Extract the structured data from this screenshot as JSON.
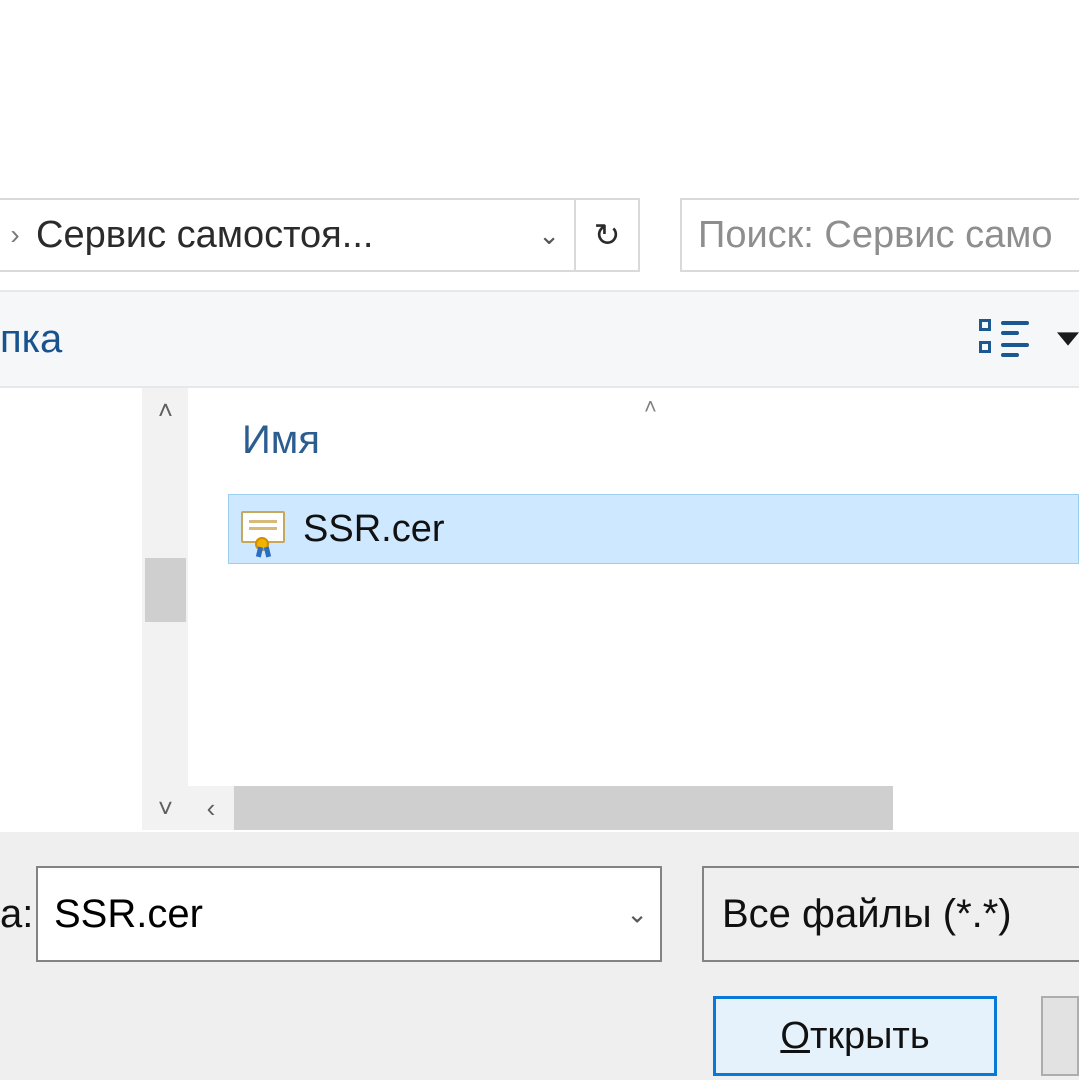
{
  "breadcrumb": {
    "caret": "›",
    "text": "Сервис самостоя...",
    "dropdown_glyph": "⌄"
  },
  "refresh": {
    "glyph": "↻"
  },
  "search": {
    "placeholder": "Поиск: Сервис само"
  },
  "toolbar": {
    "left_fragment": "пка"
  },
  "columns": {
    "name": "Имя",
    "sort_glyph": "˄"
  },
  "files": [
    {
      "name": "SSR.cer"
    }
  ],
  "filename_row": {
    "label": "а:",
    "value": "SSR.cer",
    "dropdown_glyph": "⌄"
  },
  "filter": {
    "label": "Все файлы (*.*)"
  },
  "buttons": {
    "open_pre": "О",
    "open_rest": "ткрыть"
  },
  "scroll_glyphs": {
    "up": "˄",
    "down": "˅",
    "left": "‹"
  }
}
